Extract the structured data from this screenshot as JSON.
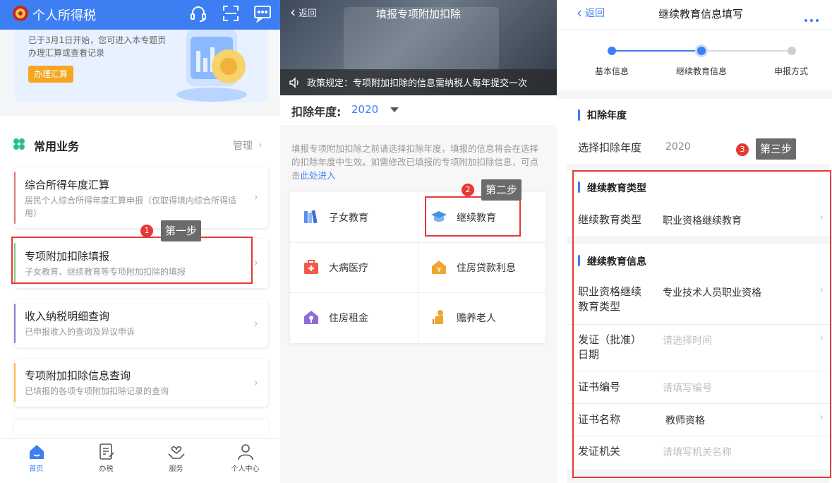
{
  "panel1": {
    "app_title": "个人所得税",
    "banner_text": "已于3月1日开始，您可进入本专题页办理汇算或查看记录",
    "banner_button": "办理汇算",
    "section_title": "常用业务",
    "manage_label": "管理",
    "cards": [
      {
        "title": "综合所得年度汇算",
        "subtitle": "居民个人综合所得年度汇算申报（仅取得境内综合所得适用）"
      },
      {
        "title": "专项附加扣除填报",
        "subtitle": "子女教育、继续教育等专项附加扣除的填报"
      },
      {
        "title": "收入纳税明细查询",
        "subtitle": "已申报收入的查询及异议申诉"
      },
      {
        "title": "专项附加扣除信息查询",
        "subtitle": "已填报的各项专项附加扣除记录的查询"
      }
    ],
    "tabs": [
      {
        "label": "首页",
        "icon": "home-icon"
      },
      {
        "label": "办税",
        "icon": "document-icon"
      },
      {
        "label": "服务",
        "icon": "heart-hands-icon"
      },
      {
        "label": "个人中心",
        "icon": "person-icon"
      }
    ],
    "step_badge": "1",
    "step_label": "第一步"
  },
  "panel2": {
    "back_label": "返回",
    "page_title": "填报专项附加扣除",
    "notice": "政策规定：专项附加扣除的信息需纳税人每年提交一次",
    "year_label": "扣除年度:",
    "year_value": "2020",
    "hint_text": "填报专项附加扣除之前请选择扣除年度，填报的信息将会在选择的扣除年度中生效。如需修改已填报的专项附加扣除信息，可点击",
    "hint_link": "此处进入",
    "items": [
      {
        "label": "子女教育",
        "icon": "books-icon",
        "color": "#5b8def"
      },
      {
        "label": "继续教育",
        "icon": "graduation-cap-icon",
        "color": "#4a90e2"
      },
      {
        "label": "大病医疗",
        "icon": "medical-kit-icon",
        "color": "#f05a4a"
      },
      {
        "label": "住房贷款利息",
        "icon": "house-yuan-icon",
        "color": "#f0a532"
      },
      {
        "label": "住房租金",
        "icon": "house-key-icon",
        "color": "#8e6bd8"
      },
      {
        "label": "赡养老人",
        "icon": "elder-icon",
        "color": "#f0a532"
      }
    ],
    "step_badge": "2",
    "step_label": "第二步"
  },
  "panel3": {
    "back_label": "返回",
    "page_title": "继续教育信息填写",
    "more_icon": "more-icon",
    "steps": [
      "基本信息",
      "继续教育信息",
      "申报方式"
    ],
    "sec_year_title": "扣除年度",
    "year_row": {
      "label": "选择扣除年度",
      "value": "2020"
    },
    "sec_type_title": "继续教育类型",
    "type_row": {
      "label": "继续教育类型",
      "value": "职业资格继续教育"
    },
    "sec_info_title": "继续教育信息",
    "rows": [
      {
        "label": "职业资格继续教育类型",
        "value": "专业技术人员职业资格",
        "placeholder": ""
      },
      {
        "label": "发证（批准）日期",
        "value": "",
        "placeholder": "请选择时间"
      },
      {
        "label": "证书编号",
        "value": "",
        "placeholder": "请填写编号"
      },
      {
        "label": "证书名称",
        "value": "教师资格",
        "placeholder": ""
      },
      {
        "label": "发证机关",
        "value": "",
        "placeholder": "请填写机关名称"
      }
    ],
    "step_badge": "3",
    "step_label": "第三步"
  },
  "colors": {
    "brand": "#3d7ff2",
    "annotation": "#e53935",
    "orange_button": "#f5a623"
  }
}
